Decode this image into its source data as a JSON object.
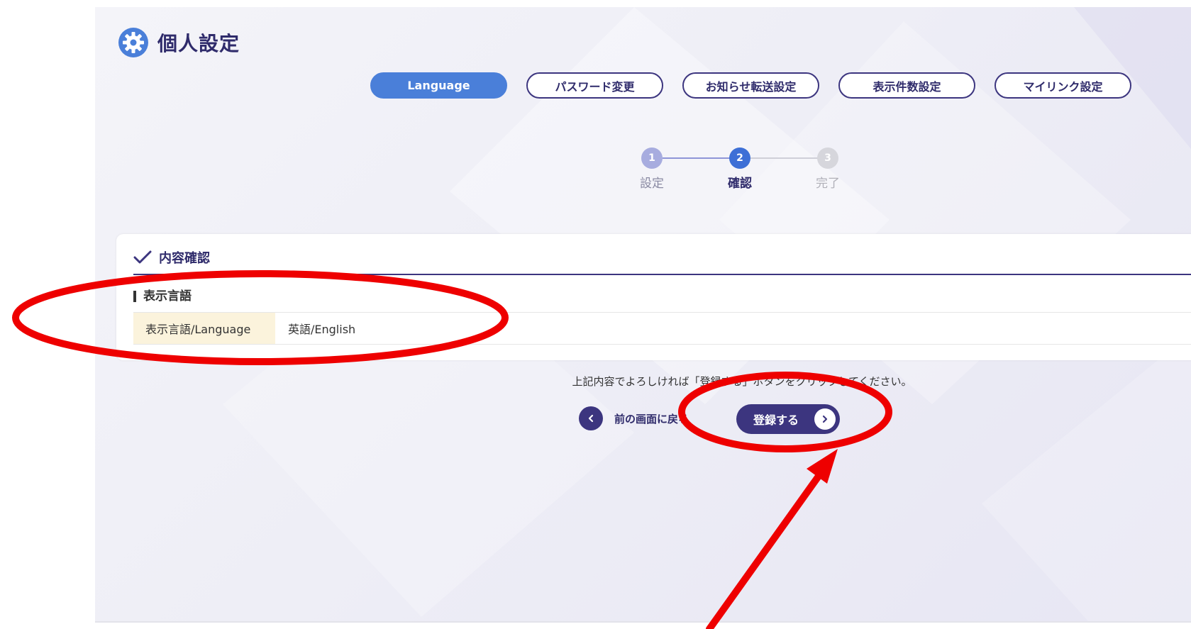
{
  "page": {
    "title": "個人設定"
  },
  "tabs": [
    {
      "label": "Language",
      "active": true
    },
    {
      "label": "パスワード変更",
      "active": false
    },
    {
      "label": "お知らせ転送設定",
      "active": false
    },
    {
      "label": "表示件数設定",
      "active": false
    },
    {
      "label": "マイリンク設定",
      "active": false
    }
  ],
  "stepper": {
    "current": 2,
    "steps": [
      {
        "number": "1",
        "label": "設定",
        "state": "done"
      },
      {
        "number": "2",
        "label": "確認",
        "state": "current"
      },
      {
        "number": "3",
        "label": "完了",
        "state": "upcoming"
      }
    ]
  },
  "confirm": {
    "title": "内容確認",
    "section_title": "表示言語",
    "row": {
      "label": "表示言語/Language",
      "value": "英語/English"
    }
  },
  "instruction": "上記内容でよろしければ「登録する」ボタンをクリックしてください。",
  "actions": {
    "back_label": "前の画面に戻る",
    "register_label": "登録する"
  },
  "icons": {
    "title": "gear-icon",
    "confirm": "check-icon",
    "back": "chevron-left-icon",
    "register": "chevron-right-icon"
  },
  "colors": {
    "primary": "#3c357f",
    "active_tab": "#4a7fd9",
    "label_bg": "#fbf3dc",
    "annotation": "#ee0000"
  }
}
